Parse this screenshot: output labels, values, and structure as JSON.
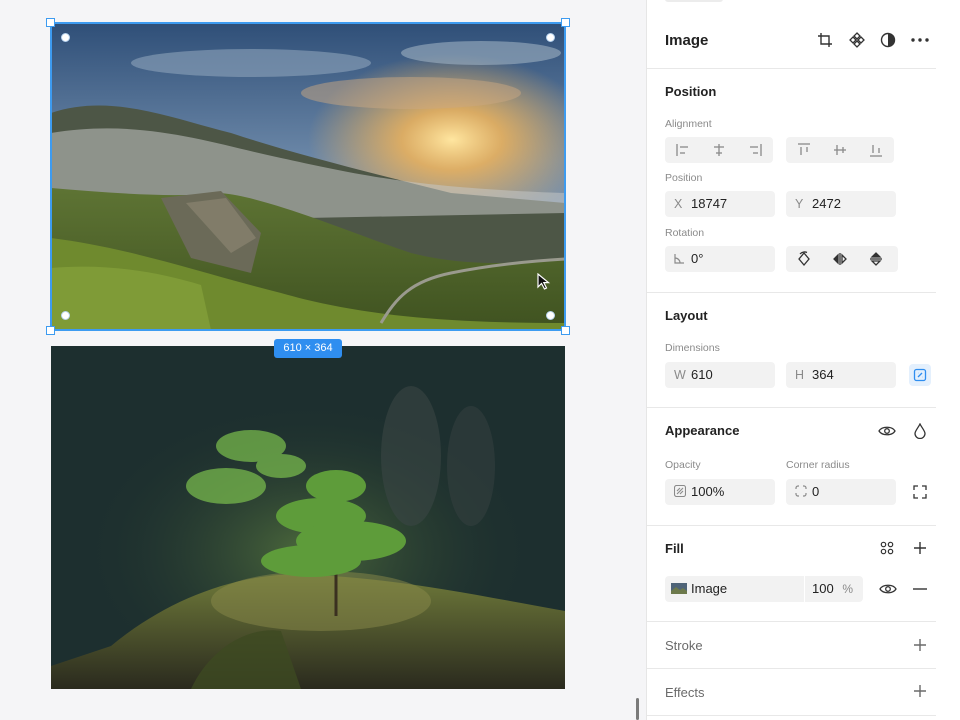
{
  "canvas": {
    "selection_size_label": "610 × 364",
    "images": [
      {
        "name": "landscape-image",
        "subject": "misty mountain valley at sunset"
      },
      {
        "name": "forest-image",
        "subject": "small fir seedling on mossy forest floor"
      }
    ]
  },
  "panel": {
    "header": {
      "title": "Image",
      "icons": [
        "crop-icon",
        "component-icon",
        "contrast-icon",
        "more-icon"
      ]
    },
    "position": {
      "title": "Position",
      "alignment_label": "Alignment",
      "position_label": "Position",
      "x_prefix": "X",
      "x_value": "18747",
      "y_prefix": "Y",
      "y_value": "2472",
      "rotation_label": "Rotation",
      "rotation_value": "0°"
    },
    "layout": {
      "title": "Layout",
      "dimensions_label": "Dimensions",
      "w_prefix": "W",
      "w_value": "610",
      "h_prefix": "H",
      "h_value": "364"
    },
    "appearance": {
      "title": "Appearance",
      "opacity_label": "Opacity",
      "opacity_value": "100%",
      "radius_label": "Corner radius",
      "radius_value": "0"
    },
    "fill": {
      "title": "Fill",
      "item_label": "Image",
      "item_opacity": "100",
      "item_unit": "%"
    },
    "stroke": {
      "title": "Stroke"
    },
    "effects": {
      "title": "Effects"
    }
  },
  "colors": {
    "accent": "#3d9bf0",
    "canvas_bg": "#f5f5f7",
    "panel_bg": "#ffffff",
    "field_bg": "#f2f2f2"
  }
}
